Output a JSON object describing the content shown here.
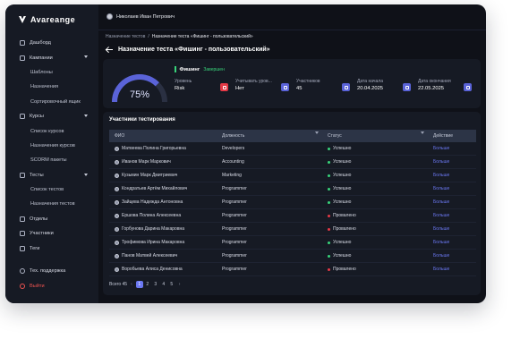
{
  "brand": {
    "name": "Avareange"
  },
  "sidebar": {
    "items": [
      {
        "label": "Дашборд",
        "icon": "grid-icon",
        "type": "top"
      },
      {
        "label": "Кампании",
        "icon": "campaign-icon",
        "type": "top",
        "expandable": true
      },
      {
        "label": "Шаблоны",
        "type": "sub"
      },
      {
        "label": "Назначения",
        "type": "sub"
      },
      {
        "label": "Сортировочный ящик",
        "type": "sub"
      },
      {
        "label": "Курсы",
        "icon": "book-icon",
        "type": "top",
        "expandable": true
      },
      {
        "label": "Список курсов",
        "type": "sub"
      },
      {
        "label": "Назначения курсов",
        "type": "sub"
      },
      {
        "label": "SCORM пакеты",
        "type": "sub"
      },
      {
        "label": "Тесты",
        "icon": "test-icon",
        "type": "top",
        "expandable": true
      },
      {
        "label": "Список тестов",
        "type": "sub"
      },
      {
        "label": "Назначения тестов",
        "type": "sub"
      },
      {
        "label": "Отделы",
        "icon": "department-icon",
        "type": "top"
      },
      {
        "label": "Участники",
        "icon": "users-icon",
        "type": "top"
      },
      {
        "label": "Теги",
        "icon": "tag-icon",
        "type": "top"
      }
    ],
    "support_label": "Тех. поддержка",
    "logout_label": "Выйти"
  },
  "topbar": {
    "user_name": "Николаев Иван Петрович"
  },
  "breadcrumb": {
    "parent": "Назначение тестов",
    "separator": "/",
    "current": "Назначение теста «Фишинг - пользовательский»"
  },
  "page_title": "Назначение теста «Фишинг - пользовательский»",
  "summary": {
    "progress_percent": 75,
    "progress_label": "75%",
    "test_name": "Фишинг",
    "status": "Завершен",
    "stats": [
      {
        "label": "Уровень",
        "value": "Risk",
        "color": "#e53946"
      },
      {
        "label": "Учитывать уров...",
        "value": "Нет",
        "color": "#5a63d8"
      },
      {
        "label": "Участников",
        "value": "45",
        "color": "#5a63d8"
      },
      {
        "label": "Дата начала",
        "value": "20.04.2025",
        "color": "#5a63d8"
      },
      {
        "label": "Дата окончания",
        "value": "22.05.2025",
        "color": "#5a63d8"
      }
    ]
  },
  "table": {
    "title": "Участники тестирования",
    "headers": {
      "name": "ФИО",
      "position": "Должность",
      "status": "Статус",
      "action": "Действие"
    },
    "rows": [
      {
        "name": "Матвеева Полина Григорьевна",
        "position": "Developers",
        "status": "Успешно",
        "status_color": "#38d37a",
        "action": "Больше"
      },
      {
        "name": "Иванов Марк Маркович",
        "position": "Accounting",
        "status": "Успешно",
        "status_color": "#38d37a",
        "action": "Больше"
      },
      {
        "name": "Кузьмин Марк Дмитриевич",
        "position": "Marketing",
        "status": "Успешно",
        "status_color": "#38d37a",
        "action": "Больше"
      },
      {
        "name": "Кондратьев Артём Михайлович",
        "position": "Programmer",
        "status": "Успешно",
        "status_color": "#38d37a",
        "action": "Больше"
      },
      {
        "name": "Зайцева Надежда Антоновна",
        "position": "Programmer",
        "status": "Успешно",
        "status_color": "#38d37a",
        "action": "Больше"
      },
      {
        "name": "Ершова Полина Алексеевна",
        "position": "Programmer",
        "status": "Провалено",
        "status_color": "#e53946",
        "action": "Больше"
      },
      {
        "name": "Горбунова Дарина Макаровна",
        "position": "Programmer",
        "status": "Провалено",
        "status_color": "#e53946",
        "action": "Больше"
      },
      {
        "name": "Трофимова Ирина Макаровна",
        "position": "Programmer",
        "status": "Успешно",
        "status_color": "#38d37a",
        "action": "Больше"
      },
      {
        "name": "Панов Матвей Алексеевич",
        "position": "Programmer",
        "status": "Успешно",
        "status_color": "#38d37a",
        "action": "Больше"
      },
      {
        "name": "Воробьева Алиса Денисовна",
        "position": "Programmer",
        "status": "Провалено",
        "status_color": "#e53946",
        "action": "Больше"
      }
    ]
  },
  "pagination": {
    "total_label": "Всего 45",
    "pages": [
      "1",
      "2",
      "3",
      "4",
      "5"
    ],
    "current_page": 1
  },
  "colors": {
    "accent": "#6b78f2",
    "success": "#38d37a",
    "danger": "#e53946",
    "background": "#0f1118",
    "panel": "#161a24"
  }
}
